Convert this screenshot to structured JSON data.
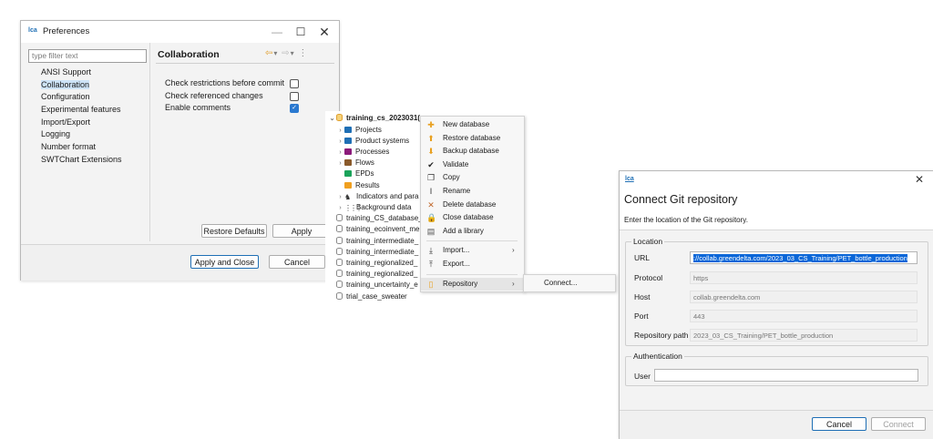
{
  "preferences": {
    "logo_text": "lca",
    "title": "Preferences",
    "filter_placeholder": "type filter text",
    "tree_items": [
      "ANSI Support",
      "Collaboration",
      "Configuration",
      "Experimental features",
      "Import/Export",
      "Logging",
      "Number format",
      "SWTChart Extensions"
    ],
    "selected_item": "Collaboration",
    "page_title": "Collaboration",
    "options": [
      {
        "label": "Check restrictions before commit",
        "checked": false
      },
      {
        "label": "Check referenced changes",
        "checked": false
      },
      {
        "label": "Enable comments",
        "checked": true
      }
    ],
    "restore_defaults_label": "Restore Defaults",
    "apply_label": "Apply",
    "apply_close_label": "Apply and Close",
    "cancel_label": "Cancel"
  },
  "navigator": {
    "root": "training_cs_2023031(",
    "children": [
      {
        "label": "Projects",
        "icon": "folder-icon",
        "color": "#1f6fb5",
        "expandable": true
      },
      {
        "label": "Product systems",
        "icon": "folder-icon",
        "color": "#1f6fb5",
        "expandable": true
      },
      {
        "label": "Processes",
        "icon": "folder-icon",
        "color": "#8b1a7a",
        "expandable": true
      },
      {
        "label": "Flows",
        "icon": "folder-icon",
        "color": "#8a5a2b",
        "expandable": true
      },
      {
        "label": "EPDs",
        "icon": "folder-icon",
        "color": "#1aa35a",
        "expandable": false
      },
      {
        "label": "Results",
        "icon": "folder-icon",
        "color": "#f0a020",
        "expandable": false
      },
      {
        "label": "Indicators and para",
        "icon": "indicators-icon",
        "color": "#333333",
        "expandable": true
      },
      {
        "label": "Background data",
        "icon": "grid-icon",
        "color": "#333333",
        "expandable": true
      }
    ],
    "databases": [
      "training_CS_database_",
      "training_ecoinvent_me",
      "training_intermediate_",
      "training_intermediate_",
      "training_regionalized_",
      "training_regionalized_",
      "training_uncertainty_e",
      "trial_case_sweater"
    ]
  },
  "context_menu": {
    "items": [
      {
        "label": "New database",
        "icon": "new-database-icon",
        "glyph": "✚",
        "color": "#e8a020"
      },
      {
        "label": "Restore database",
        "icon": "restore-database-icon",
        "glyph": "⬆",
        "color": "#e8a020"
      },
      {
        "label": "Backup database",
        "icon": "backup-database-icon",
        "glyph": "⬇",
        "color": "#e8a020"
      },
      {
        "label": "Validate",
        "icon": "validate-icon",
        "glyph": "✔",
        "color": "#222222"
      },
      {
        "label": "Copy",
        "icon": "copy-icon",
        "glyph": "❐",
        "color": "#333333"
      },
      {
        "label": "Rename",
        "icon": "rename-icon",
        "glyph": "I",
        "color": "#333333"
      },
      {
        "label": "Delete database",
        "icon": "delete-icon",
        "glyph": "✕",
        "color": "#c0672a"
      },
      {
        "label": "Close database",
        "icon": "lock-icon",
        "glyph": "🔒",
        "color": "#222222"
      },
      {
        "label": "Add a library",
        "icon": "library-icon",
        "glyph": "▤",
        "color": "#555555"
      },
      {
        "label": "Import...",
        "icon": "import-icon",
        "glyph": "⤓",
        "color": "#333333",
        "submenu": true
      },
      {
        "label": "Export...",
        "icon": "export-icon",
        "glyph": "⤒",
        "color": "#333333"
      },
      {
        "label": "Repository",
        "icon": "repository-icon",
        "glyph": "▯",
        "color": "#e8a020",
        "submenu": true
      }
    ],
    "submenu_item": "Connect..."
  },
  "git_dialog": {
    "logo_text": "lca",
    "title": "Connect Git repository",
    "description": "Enter the location of the Git repository.",
    "location_group": "Location",
    "url_label": "URL",
    "url_value": "://collab.greendelta.com/2023_03_CS_Training/PET_bottle_production",
    "protocol_label": "Protocol",
    "protocol_value": "https",
    "host_label": "Host",
    "host_value": "collab.greendelta.com",
    "port_label": "Port",
    "port_value": "443",
    "repo_path_label": "Repository path",
    "repo_path_value": "2023_03_CS_Training/PET_bottle_production",
    "auth_group": "Authentication",
    "user_label": "User",
    "user_value": "",
    "cancel_label": "Cancel",
    "connect_label": "Connect"
  }
}
